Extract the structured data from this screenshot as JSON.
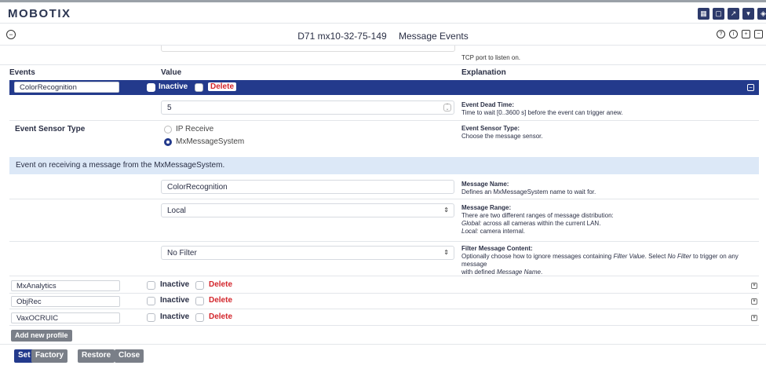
{
  "brand": {
    "logo": "MOBOTIX"
  },
  "toolbar_icons": [
    "grid-icon",
    "window-icon",
    "external-icon",
    "dropdown-icon",
    "settings-icon"
  ],
  "title": {
    "device": "D71 mx10-32-75-149",
    "page": "Message Events"
  },
  "help_icons": [
    "help-icon",
    "info-icon",
    "expand-all-icon",
    "collapse-all-icon"
  ],
  "tcp_explanation": "TCP port to listen on.",
  "headers": {
    "events": "Events",
    "value": "Value",
    "explanation": "Explanation"
  },
  "active_profile": {
    "name": "ColorRecognition",
    "inactive_label": "Inactive",
    "delete_label": "Delete",
    "dead_time": {
      "value": "5",
      "title": "Event Dead Time:",
      "text": "Time to wait [0..3600 s] before the event can trigger anew."
    },
    "sensor_type": {
      "label": "Event Sensor Type",
      "options": [
        "IP Receive",
        "MxMessageSystem"
      ],
      "selected": "MxMessageSystem",
      "title": "Event Sensor Type:",
      "text": "Choose the message sensor."
    },
    "info": "Event on receiving a message from the MxMessageSystem.",
    "message_name": {
      "value": "ColorRecognition",
      "title": "Message Name:",
      "text": "Defines an MxMessageSystem name to wait for."
    },
    "message_range": {
      "value": "Local",
      "title": "Message Range:",
      "line1": "There are two different ranges of message distribution:",
      "line2_em": "Global:",
      "line2": " across all cameras within the current LAN.",
      "line3_em": "Local:",
      "line3": " camera internal."
    },
    "filter": {
      "value": "No Filter",
      "title": "Filter Message Content:",
      "line1a": "Optionally choose how to ignore messages containing ",
      "line1b_em": "Filter Value",
      "line1c": ". Select ",
      "line1d_em": "No Filter",
      "line1e": " to trigger on any message",
      "line2a": "with defined ",
      "line2b_em": "Message Name",
      "line2c": "."
    }
  },
  "profiles": [
    {
      "name": "MxAnalytics",
      "inactive_label": "Inactive",
      "delete_label": "Delete"
    },
    {
      "name": "ObjRec",
      "inactive_label": "Inactive",
      "delete_label": "Delete"
    },
    {
      "name": "VaxOCRUIC",
      "inactive_label": "Inactive",
      "delete_label": "Delete"
    }
  ],
  "add_profile_label": "Add new profile",
  "footer_buttons": {
    "set": "Set",
    "factory": "Factory",
    "restore": "Restore",
    "close": "Close"
  }
}
